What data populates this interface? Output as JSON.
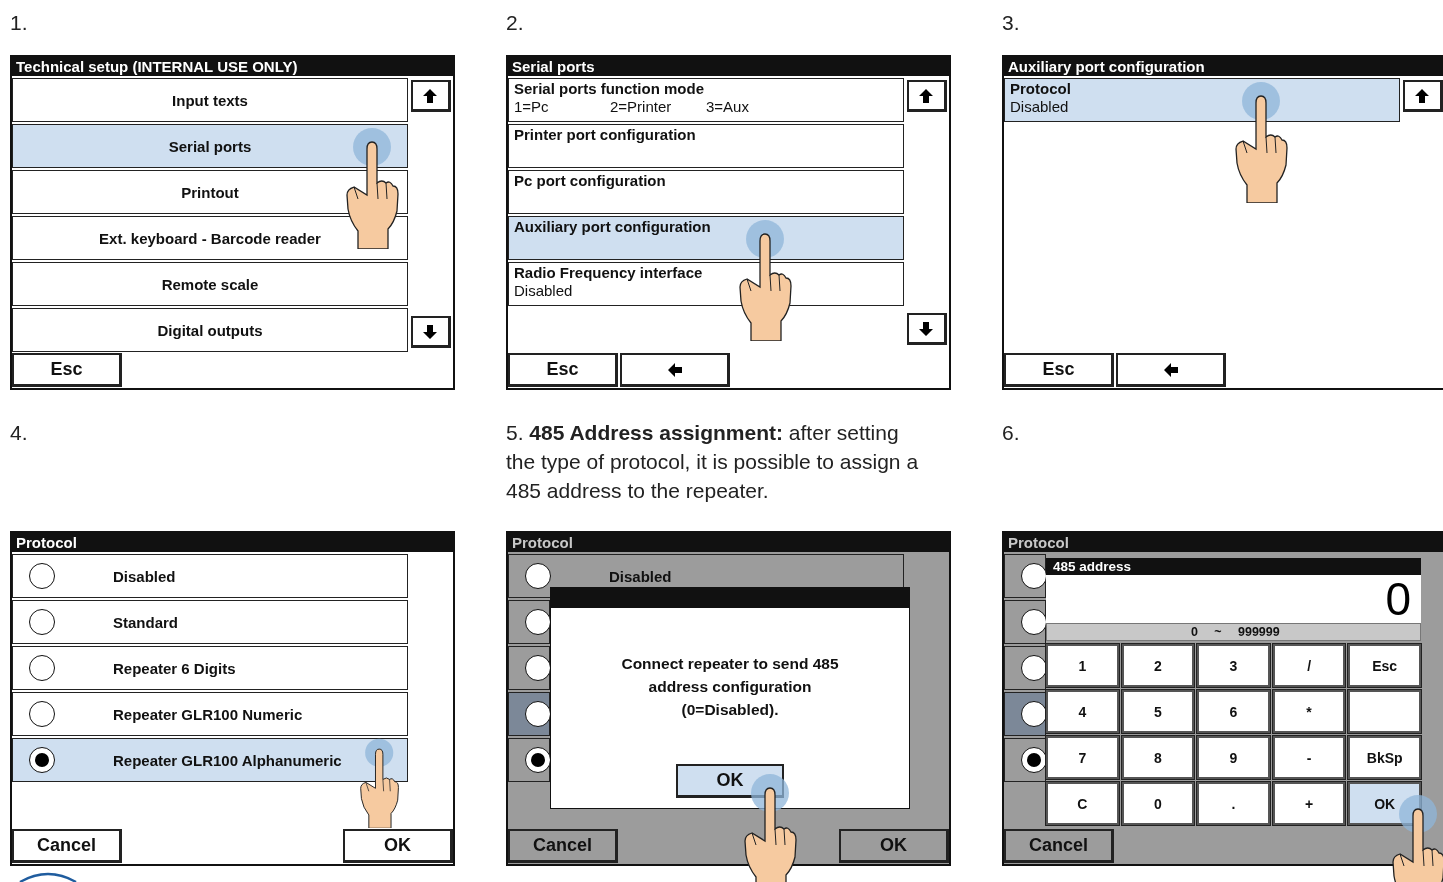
{
  "steps": [
    {
      "number": "1.",
      "screen": {
        "kind": "menu",
        "title": "Technical setup (INTERNAL USE ONLY)",
        "dimmed": false,
        "scroll_up": true,
        "scroll_down": true,
        "items": [
          {
            "label": "Input texts",
            "selected": false
          },
          {
            "label": "Serial ports",
            "selected": true
          },
          {
            "label": "Printout",
            "selected": false
          },
          {
            "label": "Ext. keyboard - Barcode reader",
            "selected": false
          },
          {
            "label": "Remote scale",
            "selected": false
          },
          {
            "label": "Digital outputs",
            "selected": false
          }
        ],
        "buttons": [
          {
            "kind": "text",
            "label": "Esc"
          }
        ]
      }
    },
    {
      "number": "2.",
      "screen": {
        "kind": "list",
        "title": "Serial ports",
        "dimmed": false,
        "scroll_up": true,
        "scroll_down": true,
        "items": [
          {
            "label": "Serial ports function mode",
            "details": [
              "1=Pc",
              "2=Printer",
              "3=Aux"
            ],
            "selected": false
          },
          {
            "label": "Printer port configuration",
            "selected": false
          },
          {
            "label": "Pc port configuration",
            "selected": false
          },
          {
            "label": "Auxiliary port configuration",
            "selected": true
          },
          {
            "label": "Radio Frequency interface",
            "details": [
              "Disabled"
            ],
            "selected": false
          }
        ],
        "buttons": [
          {
            "kind": "text",
            "label": "Esc"
          },
          {
            "kind": "back"
          }
        ]
      }
    },
    {
      "number": "3.",
      "screen": {
        "kind": "list",
        "title": "Auxiliary port configuration",
        "dimmed": false,
        "scroll_up": true,
        "scroll_down": false,
        "items": [
          {
            "label": "Protocol",
            "details": [
              "Disabled"
            ],
            "selected": true
          }
        ],
        "buttons": [
          {
            "kind": "text",
            "label": "Esc"
          },
          {
            "kind": "back"
          }
        ]
      }
    },
    {
      "number": "4.",
      "screen": {
        "kind": "radio",
        "title": "Protocol",
        "dimmed": false,
        "items": [
          {
            "label": "Disabled",
            "checked": false,
            "selected": false
          },
          {
            "label": "Standard",
            "checked": false,
            "selected": false
          },
          {
            "label": "Repeater 6 Digits",
            "checked": false,
            "selected": false
          },
          {
            "label": "Repeater GLR100 Numeric",
            "checked": false,
            "selected": false
          },
          {
            "label": "Repeater GLR100 Alphanumeric",
            "checked": true,
            "selected": true
          }
        ],
        "buttons": [
          {
            "kind": "text",
            "label": "Cancel"
          },
          {
            "kind": "text",
            "label": "OK"
          }
        ]
      }
    },
    {
      "number": "5.",
      "caption": "**485 Address assignment:** after setting the type of protocol, it is possible to assign a 485 address to the repeater.",
      "screen": {
        "kind": "radio",
        "title": "Protocol",
        "dimmed": true,
        "items": [
          {
            "label": "Disabled",
            "checked": false,
            "selected": false
          },
          {
            "checked": false,
            "selected": false
          },
          {
            "checked": false,
            "selected": false
          },
          {
            "checked": false,
            "selected": true
          },
          {
            "checked": true,
            "selected": false
          }
        ],
        "buttons": [
          {
            "kind": "text",
            "label": "Cancel"
          },
          {
            "kind": "text",
            "label": "OK"
          }
        ],
        "dialog": {
          "kind": "message",
          "text": "Connect repeater to send 485 address configuration (0=Disabled).",
          "button": {
            "label": "OK",
            "pressed": true
          }
        }
      }
    },
    {
      "number": "6.",
      "screen": {
        "kind": "radio",
        "title": "Protocol",
        "dimmed": true,
        "items": [
          {
            "checked": false,
            "selected": false
          },
          {
            "checked": false,
            "selected": false
          },
          {
            "checked": false,
            "selected": false
          },
          {
            "checked": false,
            "selected": true
          },
          {
            "checked": true,
            "selected": false
          }
        ],
        "buttons": [
          {
            "kind": "text",
            "label": "Cancel"
          }
        ],
        "dialog": {
          "kind": "keypad",
          "title": "485 address",
          "value": "0",
          "range": [
            "0",
            "~",
            "999999"
          ],
          "keys": [
            {
              "kind": "key",
              "label": "1",
              "pressed": false
            },
            {
              "kind": "key",
              "label": "2",
              "pressed": false
            },
            {
              "kind": "key",
              "label": "3",
              "pressed": false
            },
            {
              "kind": "key",
              "label": "/",
              "pressed": false
            },
            {
              "kind": "key",
              "label": "Esc",
              "pressed": false
            },
            {
              "kind": "key",
              "label": "4",
              "pressed": false
            },
            {
              "kind": "key",
              "label": "5",
              "pressed": false
            },
            {
              "kind": "key",
              "label": "6",
              "pressed": false
            },
            {
              "kind": "key",
              "label": "*",
              "pressed": false
            },
            {
              "kind": "blank",
              "pressed": false
            },
            {
              "kind": "key",
              "label": "7",
              "pressed": false
            },
            {
              "kind": "key",
              "label": "8",
              "pressed": false
            },
            {
              "kind": "key",
              "label": "9",
              "pressed": false
            },
            {
              "kind": "key",
              "label": "-",
              "pressed": false
            },
            {
              "kind": "key",
              "label": "BkSp",
              "pressed": false
            },
            {
              "kind": "key",
              "label": "C",
              "pressed": false
            },
            {
              "kind": "key",
              "label": "0",
              "pressed": false
            },
            {
              "kind": "key",
              "label": ".",
              "pressed": false
            },
            {
              "kind": "key",
              "label": "+",
              "pressed": false
            },
            {
              "kind": "key",
              "label": "OK",
              "pressed": true
            }
          ]
        }
      }
    }
  ]
}
